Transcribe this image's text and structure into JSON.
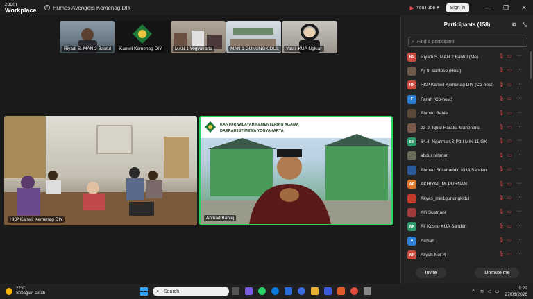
{
  "titlebar": {
    "logo_top": "zoom",
    "logo_bottom": "Workplace",
    "meeting_title": "Humas Avengers Kemenag DIY",
    "youtube_label": "YouTube",
    "signin_label": "Sign in"
  },
  "thumbnails": [
    {
      "label": "Riyadi S. MAN 2 Bantul"
    },
    {
      "label": "Kanwil Kemenag DIY"
    },
    {
      "label": "MAN 1 Yogyakarta"
    },
    {
      "label": "MAN 1 GUNUNGKIDUL"
    },
    {
      "label": "Yalal_KUA Ngluar"
    }
  ],
  "main_videos": [
    {
      "label": "HKP Kanwil Kemenag DIY"
    },
    {
      "label": "Ahmad Bahiej",
      "banner_line1": "KANTOR WILAYAH KEMENTERIAN AGAMA",
      "banner_line2": "DAERAH ISTIMEWA YOGYAKARTA"
    }
  ],
  "participants_panel": {
    "title": "Participants (158)",
    "search_placeholder": "Find a participant",
    "invite_label": "Invite",
    "unmute_label": "Unmute me",
    "participants": [
      {
        "initials": "RS",
        "name": "Riyadi S. MAN 2 Bantul (Me)",
        "color": "#c94a3c"
      },
      {
        "initials": "",
        "name": "Aji tri santoso (Host)",
        "color": "#6b5a4a"
      },
      {
        "initials": "HK",
        "name": "HKP Kanwil Kemenag DIY (Co-host)",
        "color": "#c94a3c"
      },
      {
        "initials": "F",
        "name": "Farah (Co-host)",
        "color": "#2d7fd3"
      },
      {
        "initials": "",
        "name": "Ahmad Bahiej",
        "color": "#5a4a3a"
      },
      {
        "initials": "",
        "name": "23-2_Iqbal Haraka Mahendra",
        "color": "#7a5a4a"
      },
      {
        "initials": "6M",
        "name": "64.4_Ngatman,S.Pd.I MIN 11 GK",
        "color": "#2e9a6b"
      },
      {
        "initials": "",
        "name": "abdur rahman",
        "color": "#6a6a5a"
      },
      {
        "initials": "",
        "name": "Ahmad Shilahuddin KUA Sanden",
        "color": "#2a5a9a"
      },
      {
        "initials": "AP",
        "name": "AKHIYAT_MI PURNAN",
        "color": "#e0782a"
      },
      {
        "initials": "",
        "name": "Akyas_min1gunungkidul",
        "color": "#c0392b"
      },
      {
        "initials": "",
        "name": "Alfi Sustriani",
        "color": "#a03a3a"
      },
      {
        "initials": "AK",
        "name": "Ali Kusno KUA Sanden",
        "color": "#2e9a6b"
      },
      {
        "initials": "A",
        "name": "Alimah",
        "color": "#2d7fd3"
      },
      {
        "initials": "AN",
        "name": "Aliyah Nur R",
        "color": "#c94a3c"
      }
    ]
  },
  "taskbar": {
    "temperature": "27°C",
    "weather": "Sebagian cerah",
    "search_label": "Search",
    "time": "9:22",
    "date": "27/08/2026"
  }
}
